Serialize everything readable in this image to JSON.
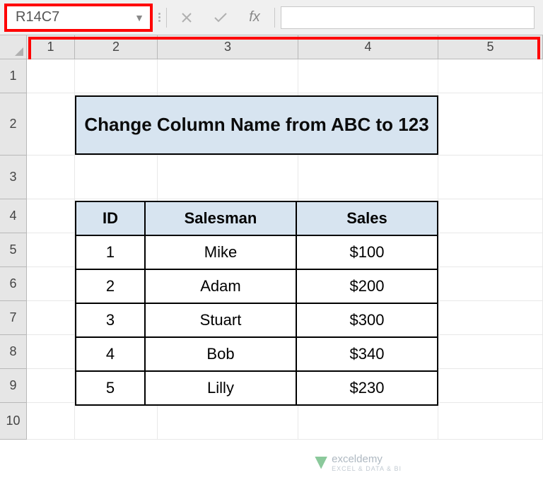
{
  "formula_bar": {
    "name_box_value": "R14C7",
    "fx_label": "fx"
  },
  "column_headers": [
    "1",
    "2",
    "3",
    "4",
    "5"
  ],
  "row_headers": [
    "1",
    "2",
    "3",
    "4",
    "5",
    "6",
    "7",
    "8",
    "9",
    "10"
  ],
  "title": "Change Column Name from ABC to 123",
  "table": {
    "headers": {
      "id": "ID",
      "salesman": "Salesman",
      "sales": "Sales"
    },
    "rows": [
      {
        "id": "1",
        "salesman": "Mike",
        "sales": "$100"
      },
      {
        "id": "2",
        "salesman": "Adam",
        "sales": "$200"
      },
      {
        "id": "3",
        "salesman": "Stuart",
        "sales": "$300"
      },
      {
        "id": "4",
        "salesman": "Bob",
        "sales": "$340"
      },
      {
        "id": "5",
        "salesman": "Lilly",
        "sales": "$230"
      }
    ]
  },
  "watermark": {
    "brand": "exceldemy",
    "tagline": "EXCEL & DATA & BI"
  },
  "chart_data": {
    "type": "table",
    "columns": [
      "ID",
      "Salesman",
      "Sales"
    ],
    "rows": [
      [
        1,
        "Mike",
        100
      ],
      [
        2,
        "Adam",
        200
      ],
      [
        3,
        "Stuart",
        300
      ],
      [
        4,
        "Bob",
        340
      ],
      [
        5,
        "Lilly",
        230
      ]
    ],
    "title": "Change Column Name from ABC to 123"
  }
}
